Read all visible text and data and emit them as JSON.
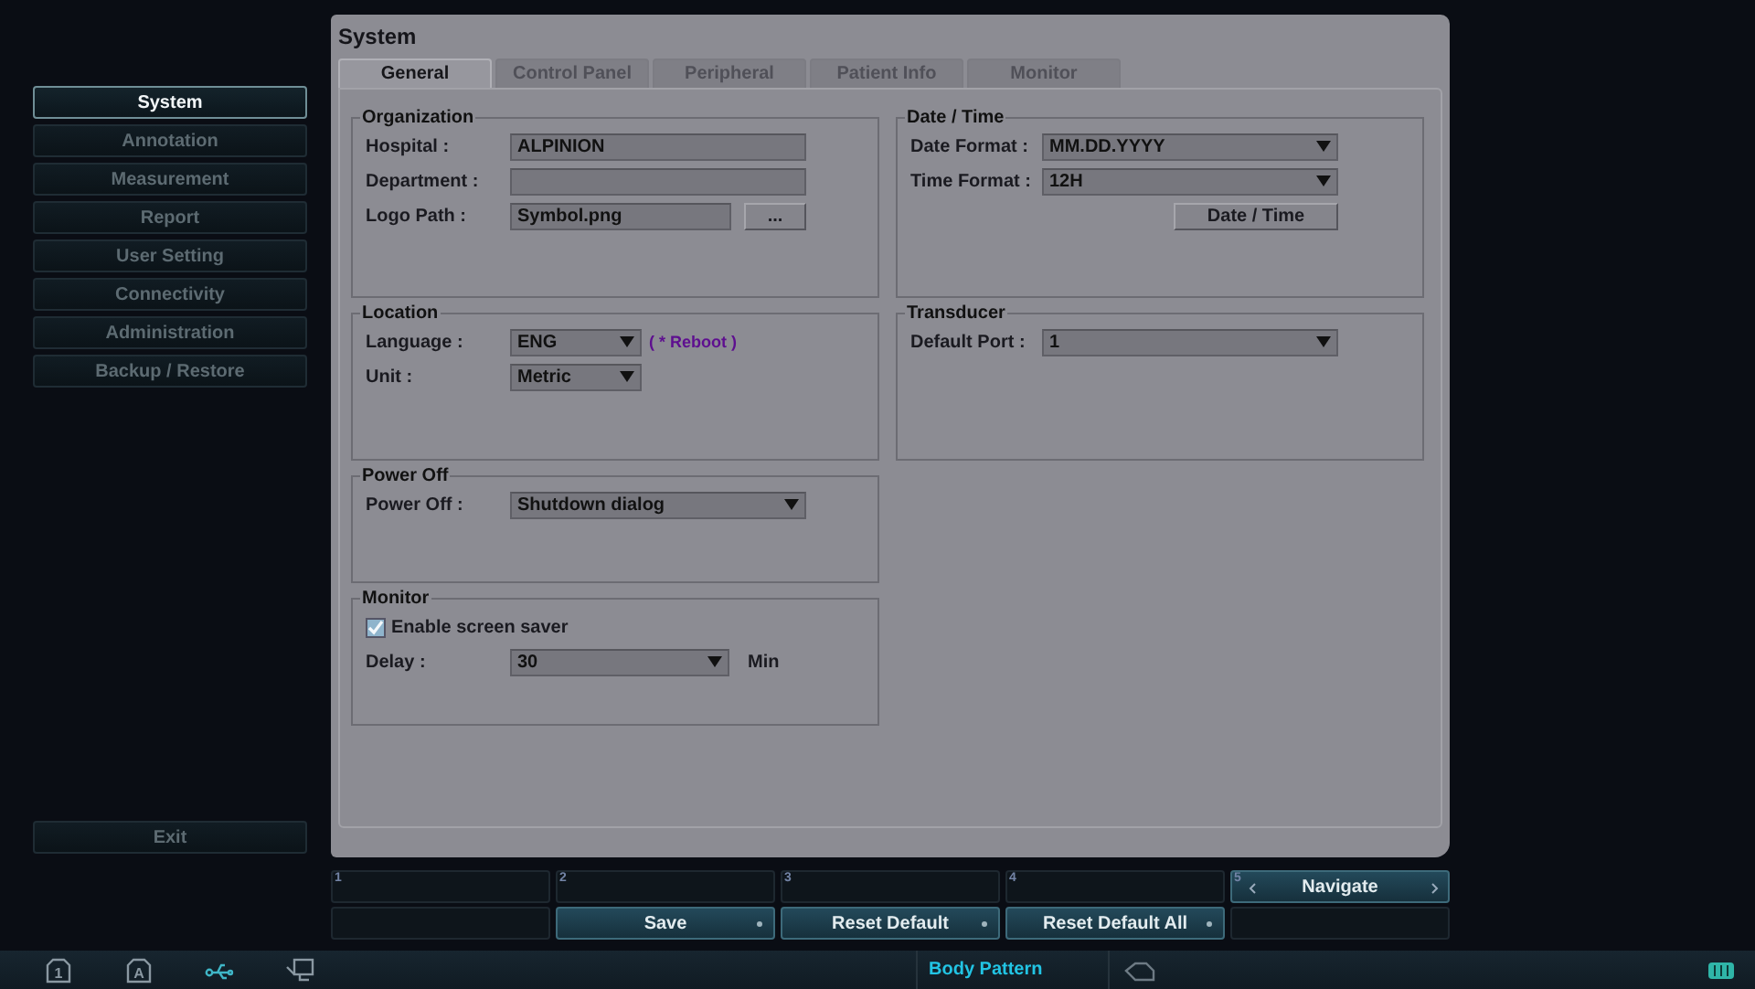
{
  "sidebar": {
    "items": [
      {
        "label": "System",
        "selected": true
      },
      {
        "label": "Annotation",
        "selected": false
      },
      {
        "label": "Measurement",
        "selected": false
      },
      {
        "label": "Report",
        "selected": false
      },
      {
        "label": "User Setting",
        "selected": false
      },
      {
        "label": "Connectivity",
        "selected": false
      },
      {
        "label": "Administration",
        "selected": false
      },
      {
        "label": "Backup / Restore",
        "selected": false
      }
    ],
    "exit": "Exit"
  },
  "panel": {
    "title": "System",
    "tabs": [
      {
        "label": "General",
        "selected": true
      },
      {
        "label": "Control Panel",
        "selected": false
      },
      {
        "label": "Peripheral",
        "selected": false
      },
      {
        "label": "Patient Info",
        "selected": false
      },
      {
        "label": "Monitor",
        "selected": false
      }
    ],
    "columns": [
      [
        {
          "title": "Organization",
          "rows": [
            {
              "kind": "text",
              "label": "Hospital :",
              "value": "ALPINION"
            },
            {
              "kind": "text",
              "label": "Department :"
            },
            {
              "kind": "browse",
              "label": "Logo Path :",
              "value": "Symbol.png",
              "button": "..."
            }
          ]
        },
        {
          "title": "Location",
          "rows": [
            {
              "kind": "select",
              "label": "Language :",
              "value": "ENG",
              "note": "( * Reboot )"
            },
            {
              "kind": "select",
              "label": "Unit :",
              "value": "Metric"
            }
          ]
        },
        {
          "title": "Power Off",
          "rows": [
            {
              "kind": "dropdown",
              "label": "Power Off :",
              "value": "Shutdown dialog"
            }
          ]
        },
        {
          "title": "Monitor",
          "rows": [
            {
              "kind": "checkbox",
              "label": "Enable screen saver",
              "checked": true
            },
            {
              "kind": "dropdown",
              "label": "Delay :",
              "value": "30",
              "unit": "Min"
            }
          ]
        }
      ],
      [
        {
          "title": "Date / Time",
          "rows": [
            {
              "kind": "dropdown",
              "label": "Date Format :",
              "value": "MM.DD.YYYY"
            },
            {
              "kind": "dropdown",
              "label": "Time Format :",
              "value": "12H"
            },
            {
              "kind": "button",
              "button": "Date / Time"
            }
          ]
        },
        {
          "title": "Transducer",
          "rows": [
            {
              "kind": "dropdown",
              "label": "Default Port :",
              "value": "1"
            }
          ]
        }
      ]
    ]
  },
  "softkeys": [
    {
      "number": "1"
    },
    {
      "number": "2",
      "bottom": "Save"
    },
    {
      "number": "3",
      "bottom": "Reset Default"
    },
    {
      "number": "4",
      "bottom": "Reset Default All"
    },
    {
      "number": "5",
      "top": "Navigate"
    }
  ],
  "status_bar": {
    "icons": [
      {
        "kind": "slot",
        "label": "1"
      },
      {
        "kind": "slot",
        "label": "A"
      },
      {
        "kind": "usb"
      },
      {
        "kind": "display"
      }
    ],
    "mode": "Body Pattern"
  }
}
